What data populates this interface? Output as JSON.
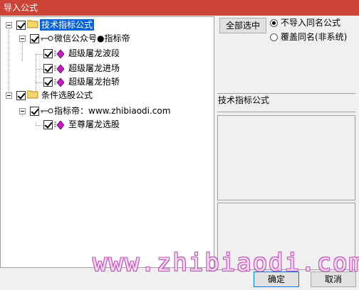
{
  "window": {
    "title": "导入公式"
  },
  "tree": {
    "items": [
      {
        "label": "技术指标公式",
        "icon": "folder-icon",
        "checked": true,
        "selected": true
      },
      {
        "label": "微信公众号●指标帝",
        "icon": "key-icon",
        "checked": true
      },
      {
        "label": "超级屠龙波段",
        "icon": "formula-icon",
        "checked": true
      },
      {
        "label": "超级屠龙进场",
        "icon": "formula-icon",
        "checked": true
      },
      {
        "label": "超级屠龙抬轿",
        "icon": "formula-icon",
        "checked": true
      },
      {
        "label": "条件选股公式",
        "icon": "folder-icon",
        "checked": true
      },
      {
        "label": "指标帝：www.zhibiaodi.com",
        "icon": "key-icon",
        "checked": true
      },
      {
        "label": "至尊屠龙选股",
        "icon": "formula-icon",
        "checked": true
      }
    ]
  },
  "actions": {
    "select_all_label": "全部选中",
    "ok_label": "确定",
    "cancel_label": "取消"
  },
  "import_options": {
    "selected": "不导入同名公式",
    "options": [
      "不导入同名公式",
      "覆盖同名(非系统)"
    ]
  },
  "detail": {
    "category_label": "技术指标公式"
  },
  "watermark": "www.zhibiaodi.com",
  "colors": {
    "titlebar": "#cc4438",
    "selection": "#0a64d8",
    "watermark_outline": "#c050b8"
  }
}
